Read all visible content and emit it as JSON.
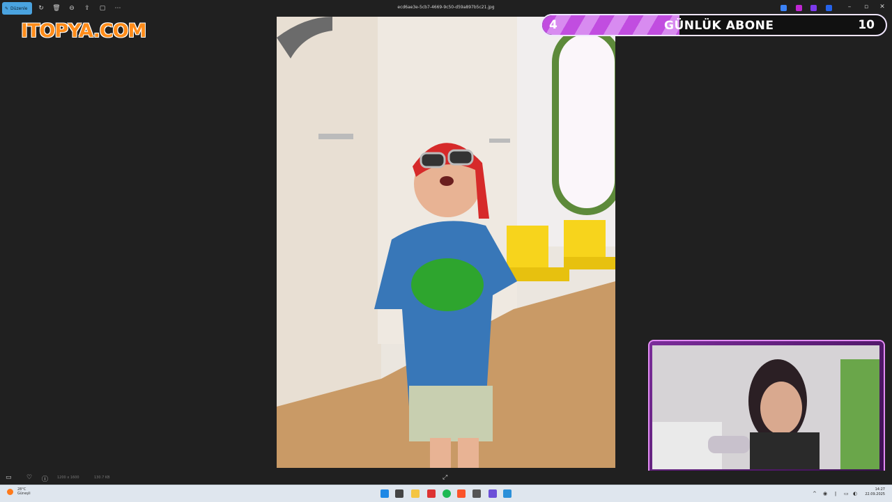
{
  "titlebar": {
    "edit_label": "Düzenle",
    "filename": "ecd6ae3e-5cb7-4669-9c50-d59a897b5c21.jpg",
    "icons": [
      "edit-icon",
      "rotate-icon",
      "delete-icon",
      "crop-icon",
      "share-icon",
      "slideshow-icon",
      "more-icon"
    ],
    "window_controls": [
      "minimize",
      "maximize",
      "close"
    ]
  },
  "overlay": {
    "logo_text": "ITOPYA.COM",
    "subscriber_goal": {
      "current": "4",
      "label": "GÜNLÜK ABONE",
      "goal": "10",
      "progress": 0.4
    }
  },
  "bottombar": {
    "dimensions": "1200 x 1600",
    "file_size": "130.7 KB"
  },
  "taskbar": {
    "weather_temp": "28°C",
    "weather_text": "Güneşli",
    "time": "14:27",
    "date": "22.09.2025"
  },
  "colors": {
    "accent": "#4aa3df",
    "logo_orange": "#ff8c1a",
    "sub_bar_fill": "#c14de0"
  }
}
